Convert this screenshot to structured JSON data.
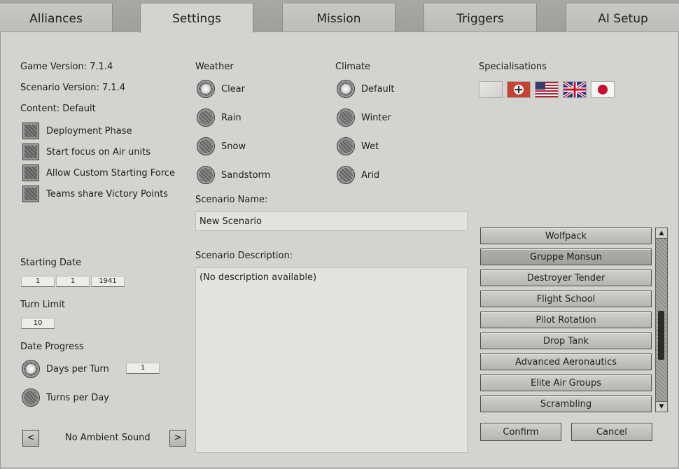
{
  "tabs": [
    "Alliances",
    "Settings",
    "Mission",
    "Triggers",
    "AI Setup"
  ],
  "info": {
    "game_version": "Game Version: 7.1.4",
    "scenario_version": "Scenario Version: 7.1.4",
    "content": "Content: Default"
  },
  "options": [
    "Deployment Phase",
    "Start focus on Air units",
    "Allow Custom Starting Force",
    "Teams share Victory Points"
  ],
  "weather": {
    "label": "Weather",
    "items": [
      "Clear",
      "Rain",
      "Snow",
      "Sandstorm"
    ],
    "selected": "Clear"
  },
  "climate": {
    "label": "Climate",
    "items": [
      "Default",
      "Winter",
      "Wet",
      "Arid"
    ],
    "selected": "Default"
  },
  "specialisations": {
    "label": "Specialisations",
    "flags": [
      "neutral-flag",
      "german-flag",
      "usa-flag",
      "uk-flag",
      "japan-flag"
    ]
  },
  "scenario_name": {
    "label": "Scenario Name:",
    "value": "New Scenario"
  },
  "scenario_description": {
    "label": "Scenario Description:",
    "value": "(No description available)"
  },
  "starting_date": {
    "label": "Starting Date",
    "day": "1",
    "month": "1",
    "year": "1941"
  },
  "turn_limit": {
    "label": "Turn Limit",
    "value": "10"
  },
  "date_progress": {
    "label": "Date Progress",
    "days_per_turn": "Days per Turn",
    "days_value": "1",
    "turns_per_day": "Turns per Day"
  },
  "ambient": {
    "prev": "<",
    "label": "No Ambient Sound",
    "next": ">"
  },
  "spec_list": [
    "Wolfpack",
    "Gruppe Monsun",
    "Destroyer Tender",
    "Flight School",
    "Pilot Rotation",
    "Drop Tank",
    "Advanced Aeronautics",
    "Elite Air Groups",
    "Scrambling"
  ],
  "spec_list_selected": "Gruppe Monsun",
  "buttons": {
    "confirm": "Confirm",
    "cancel": "Cancel"
  }
}
